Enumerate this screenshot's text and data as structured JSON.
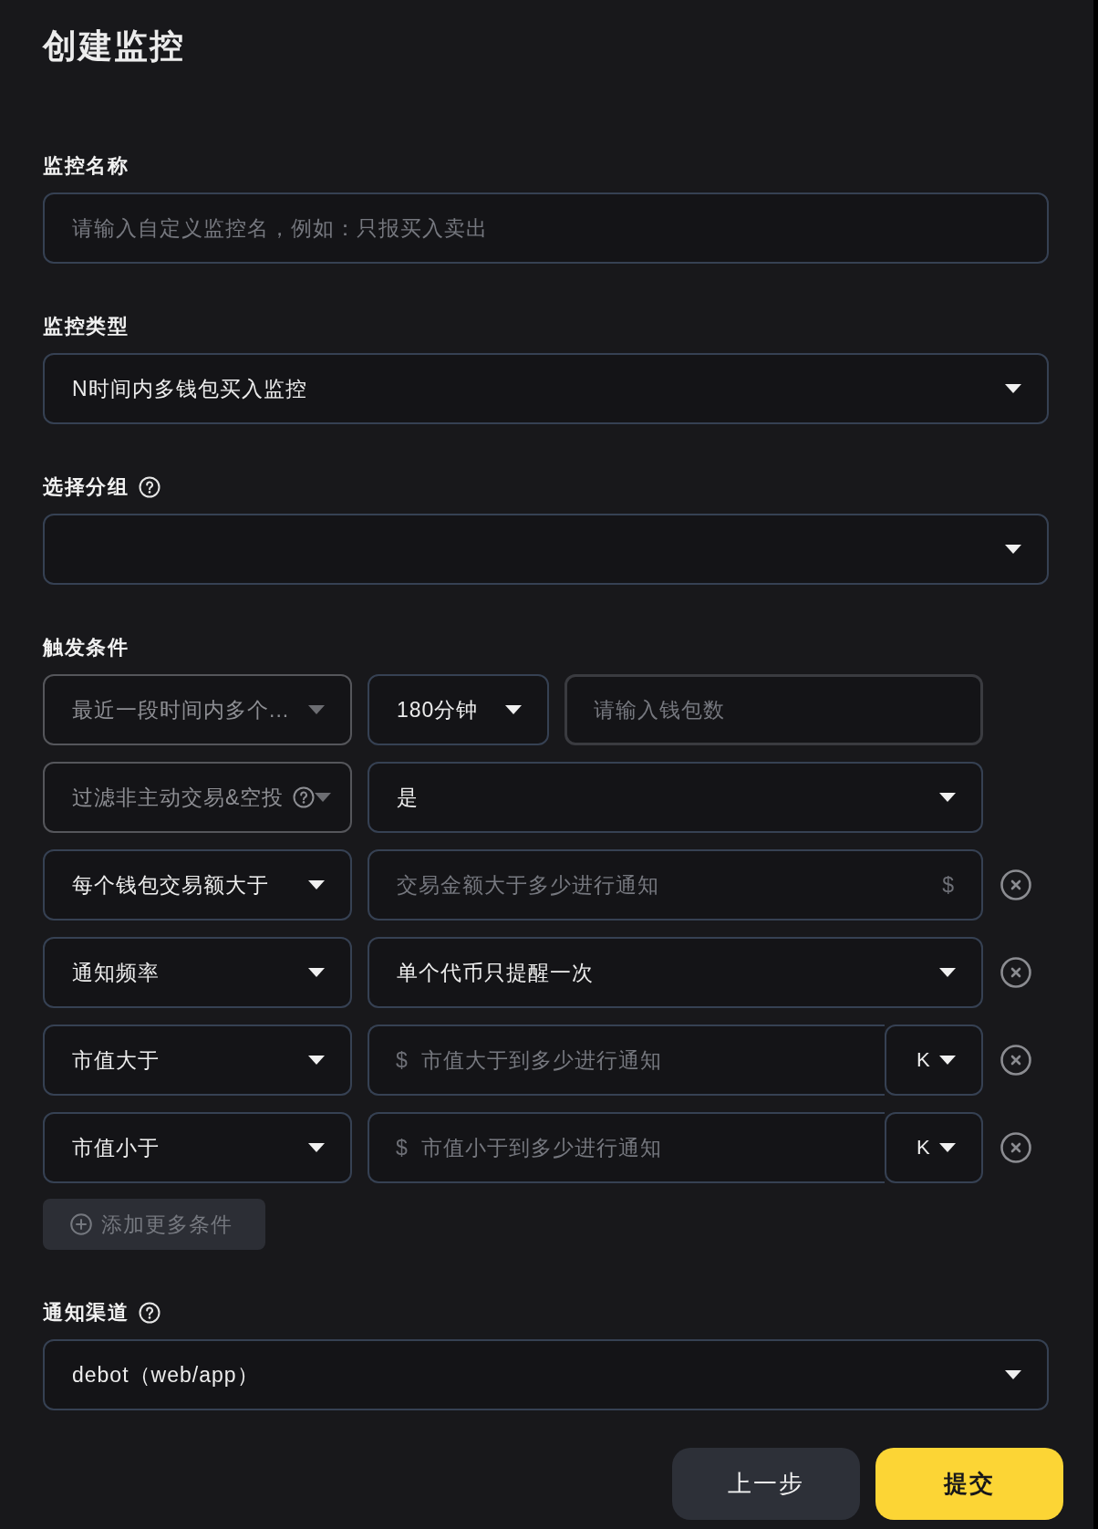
{
  "page": {
    "title": "创建监控"
  },
  "sections": [
    {
      "kind": "input",
      "label": "监控名称",
      "placeholder": "请输入自定义监控名，例如：只报买入卖出"
    },
    {
      "kind": "select",
      "label": "监控类型",
      "value": "N时间内多钱包买入监控"
    },
    {
      "kind": "select",
      "label": "选择分组",
      "help": true
    },
    {
      "kind": "conditions",
      "label": "触发条件",
      "rows": [
        {
          "cells": [
            {
              "kind": "select",
              "value": "最近一段时间内多个...",
              "disabled": true
            },
            {
              "kind": "select",
              "value": "180分钟",
              "disabled": false
            },
            {
              "kind": "number",
              "placeholder": "请输入钱包数",
              "disabled": false
            }
          ]
        },
        {
          "cells": [
            {
              "kind": "select",
              "value": "过滤非主动交易&空投",
              "disabled": true,
              "help": true
            },
            {
              "kind": "select",
              "value": "是",
              "disabled": false
            }
          ]
        },
        {
          "removable": true,
          "cells": [
            {
              "kind": "select",
              "value": "每个钱包交易额大于",
              "disabled": false
            },
            {
              "kind": "input",
              "placeholder": "交易金额大于多少进行通知",
              "suffix": "$",
              "disabled": false
            }
          ]
        },
        {
          "removable": true,
          "cells": [
            {
              "kind": "select",
              "value": "通知频率",
              "disabled": false
            },
            {
              "kind": "select",
              "value": "单个代币只提醒一次",
              "disabled": false
            }
          ]
        },
        {
          "removable": true,
          "cells": [
            {
              "kind": "select",
              "value": "市值大于",
              "disabled": false
            },
            {
              "kind": "input",
              "prefix": "$",
              "placeholder": "市值大于到多少进行通知",
              "unit": "K",
              "disabled": false
            }
          ]
        },
        {
          "removable": true,
          "cells": [
            {
              "kind": "select",
              "value": "市值小于",
              "disabled": false
            },
            {
              "kind": "input",
              "prefix": "$",
              "placeholder": "市值小于到多少进行通知",
              "unit": "K",
              "disabled": false
            }
          ]
        }
      ],
      "add_button": "添加更多条件"
    },
    {
      "kind": "select",
      "label": "通知渠道",
      "help": true,
      "value": "debot（web/app）"
    }
  ],
  "buttons": [
    {
      "kind": "secondary",
      "label": "上一步"
    },
    {
      "kind": "primary",
      "label": "提交"
    }
  ]
}
